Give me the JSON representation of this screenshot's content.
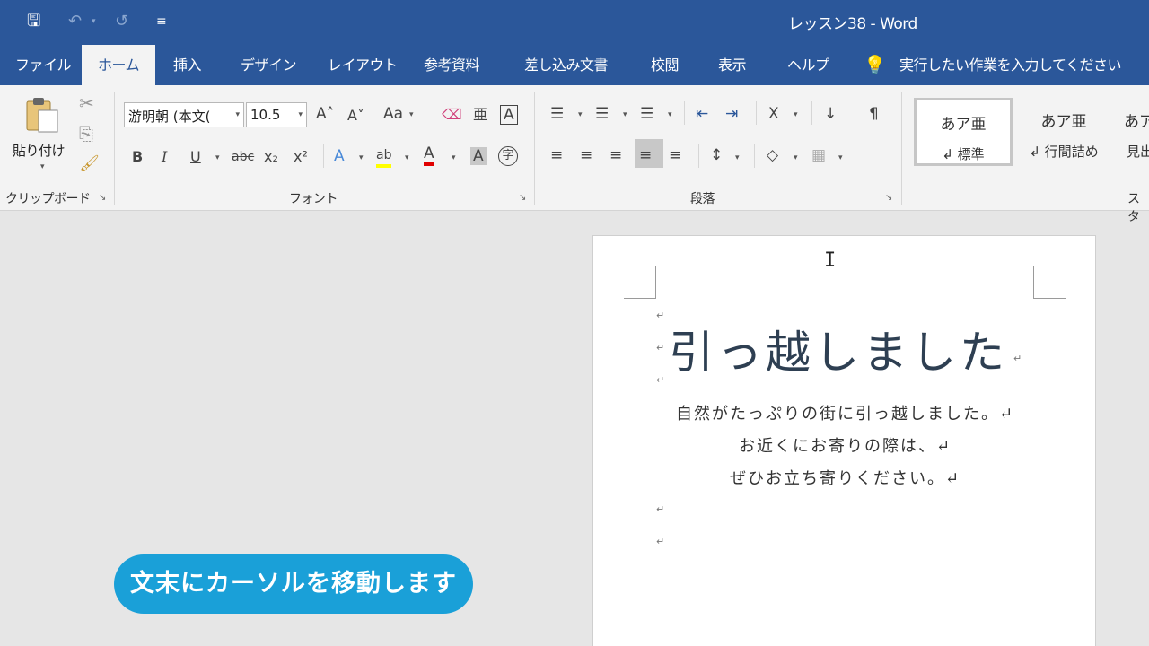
{
  "titlebar": {
    "title": "レッスン38  -  Word",
    "save_glyph": "🖫",
    "undo_glyph": "↶",
    "undo_dd": "▾",
    "redo_glyph": "↺",
    "customize_glyph": "≡"
  },
  "tabs": [
    {
      "label": "ファイル"
    },
    {
      "label": "ホーム"
    },
    {
      "label": "挿入"
    },
    {
      "label": "デザイン"
    },
    {
      "label": "レイアウト"
    },
    {
      "label": "参考資料"
    },
    {
      "label": "差し込み文書"
    },
    {
      "label": "校閲"
    },
    {
      "label": "表示"
    },
    {
      "label": "ヘルプ"
    }
  ],
  "tellme": {
    "icon": "💡",
    "label": "実行したい作業を入力してください"
  },
  "ribbon": {
    "clipboard": {
      "label": "クリップボード",
      "paste_label": "貼り付け",
      "cut": "✂",
      "copy": "⎘",
      "painter": "🖌"
    },
    "font": {
      "label": "フォント",
      "font_name": "游明朝 (本文(",
      "font_size": "10.5",
      "grow": "A˄",
      "shrink": "A˅",
      "case": "Aa",
      "clear": "⌫",
      "phonetic": "亜",
      "border": "A",
      "bold": "B",
      "italic": "I",
      "underline": "U",
      "strike": "abc",
      "subscript": "x₂",
      "superscript": "x²",
      "effects": "A",
      "highlight": "ab",
      "color": "A",
      "shading": "A",
      "enclose": "字"
    },
    "paragraph": {
      "label": "段落",
      "bullets": "☰",
      "numbering": "☰",
      "multilevel": "☰",
      "outdent": "⇤",
      "indent": "⇥",
      "asian": "X",
      "sort": "↓",
      "marks": "¶",
      "align_left": "≡",
      "center": "≡",
      "align_right": "≡",
      "justify": "≡",
      "distributed": "≡",
      "line_spacing": "↕",
      "fill": "◇",
      "borders": "▦"
    },
    "styles": {
      "label": "スタ",
      "items": [
        {
          "sample": "あア亜",
          "name": "↲ 標準"
        },
        {
          "sample": "あア亜",
          "name": "↲ 行間詰め"
        },
        {
          "sample": "あア",
          "name": "見出"
        }
      ]
    },
    "launcher": "↘"
  },
  "document": {
    "paragraph_mark": "↵",
    "title": "引っ越しました",
    "lines": [
      "自然がたっぷりの街に引っ越しました。↵",
      "お近くにお寄りの際は、↵",
      "ぜひお立ち寄りください。↵"
    ],
    "ibeam": "I"
  },
  "caption": "文末にカーソルを移動します",
  "colors": {
    "brand": "#2b579a",
    "caption_bg": "#1aa0d8"
  }
}
